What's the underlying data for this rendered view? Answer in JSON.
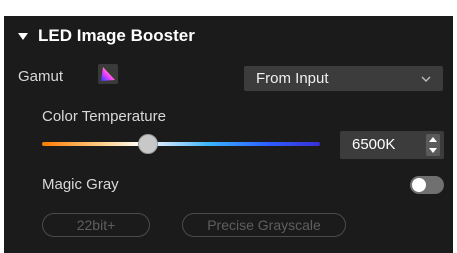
{
  "panel": {
    "title": "LED Image Booster",
    "gamut": {
      "label": "Gamut",
      "icon": "color-gamut-icon",
      "selected": "From Input"
    },
    "color_temperature": {
      "label": "Color Temperature",
      "value": "6500K",
      "slider_fraction": 0.38
    },
    "magic_gray": {
      "label": "Magic Gray",
      "enabled": false
    },
    "buttons": {
      "bit_depth": "22bit+",
      "precise_grayscale": "Precise Grayscale"
    }
  }
}
